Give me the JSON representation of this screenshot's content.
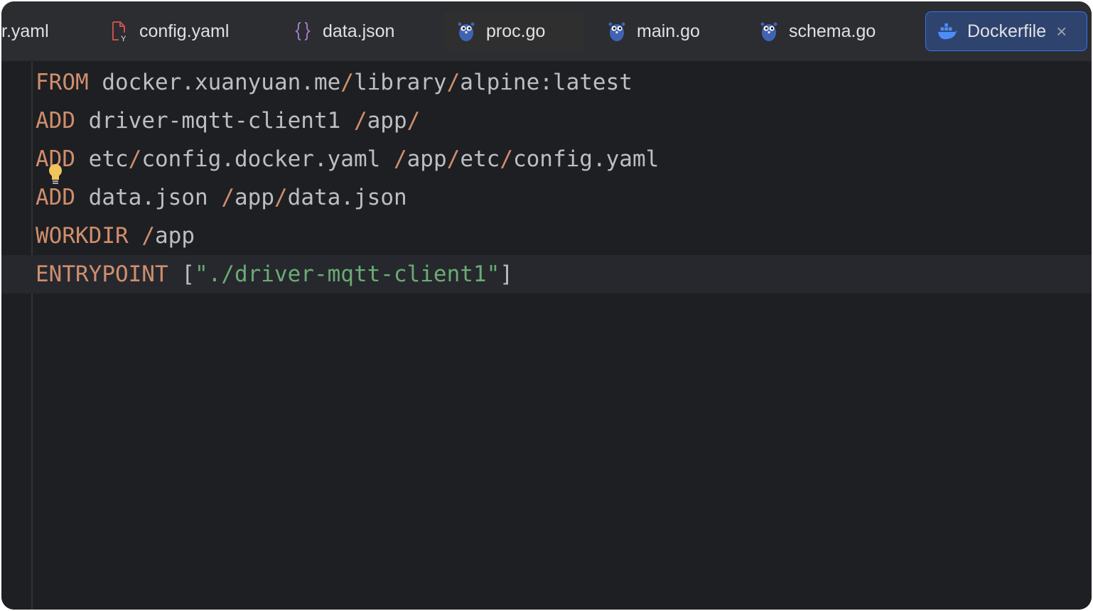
{
  "tabs": [
    {
      "label": "r.yaml",
      "icon": "yaml-file-icon"
    },
    {
      "label": "config.yaml",
      "icon": "yaml-file-icon"
    },
    {
      "label": "data.json",
      "icon": "json-braces-icon"
    },
    {
      "label": "proc.go",
      "icon": "gopher-icon"
    },
    {
      "label": "main.go",
      "icon": "gopher-icon"
    },
    {
      "label": "schema.go",
      "icon": "gopher-icon"
    },
    {
      "label": "Dockerfile",
      "icon": "docker-whale-icon",
      "close": "×"
    }
  ],
  "code": {
    "line1": {
      "kw": "FROM",
      "a": "docker.xuanyuan.me",
      "s1": "/",
      "b": "library",
      "s2": "/",
      "c": "alpine:latest"
    },
    "line2": {
      "kw": "ADD",
      "a": "driver-mqtt-client1",
      "s1": "/",
      "b": "app",
      "s2": "/"
    },
    "line3": {
      "kw": "ADD",
      "a": "etc",
      "s1": "/",
      "b": "config.docker.yaml",
      "s2": "/",
      "c": "app",
      "s3": "/",
      "d": "etc",
      "s4": "/",
      "e": "config.yaml"
    },
    "line4": {
      "kw": "ADD",
      "a": "data.json",
      "s1": "/",
      "b": "app",
      "s2": "/",
      "c": "data.json"
    },
    "line5": {
      "kw": "WORKDIR",
      "s1": "/",
      "a": "app"
    },
    "line6": {
      "kw": "ENTRYPOINT",
      "open": "[",
      "str": "\"./driver-mqtt-client1\"",
      "close": "]"
    }
  },
  "colors": {
    "background": "#1e1f22",
    "keyword": "#cf8e6d",
    "string": "#6aab73",
    "text": "#bcbec4",
    "active_tab": "#2e436e"
  }
}
